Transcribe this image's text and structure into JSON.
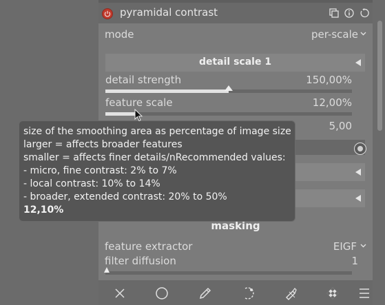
{
  "module": {
    "title": "pyramidal contrast",
    "mode_label": "mode",
    "mode_value": "per-scale",
    "section_title": "detail scale 1",
    "params": [
      {
        "label": "detail strength",
        "value": "150,00%",
        "level": 0.5
      },
      {
        "label": "feature scale",
        "value": "12,00%",
        "level": 0.12
      },
      {
        "label": "",
        "value": "5,00"
      }
    ],
    "masking_label": "masking",
    "feature_extractor_label": "feature extractor",
    "feature_extractor_value": "EIGF",
    "filter_diffusion_label": "filter diffusion",
    "filter_diffusion_value": "1"
  },
  "tooltip": {
    "lines": [
      "size of the smoothing area as percentage of image size",
      "larger = affects broader features",
      "smaller = affects finer details/nRecommended values:",
      "- micro, fine contrast: 2% to 7%",
      "- local contrast: 10% to 14%",
      "- broader, extended contrast: 20% to 50%"
    ],
    "current_value": "12,10%"
  },
  "icons": {
    "header": [
      "power-icon",
      "presets-icon",
      "info-icon",
      "reset-icon"
    ],
    "bottom": [
      "close-icon",
      "circle-icon",
      "pencil-icon",
      "curve-icon",
      "brush-icon",
      "checker-icon",
      "menu-icon"
    ]
  },
  "colors": {
    "panel_bg": "#7b7b7b",
    "header_bg": "#696969",
    "tooltip_bg": "#555555",
    "power": "#c0392b"
  }
}
